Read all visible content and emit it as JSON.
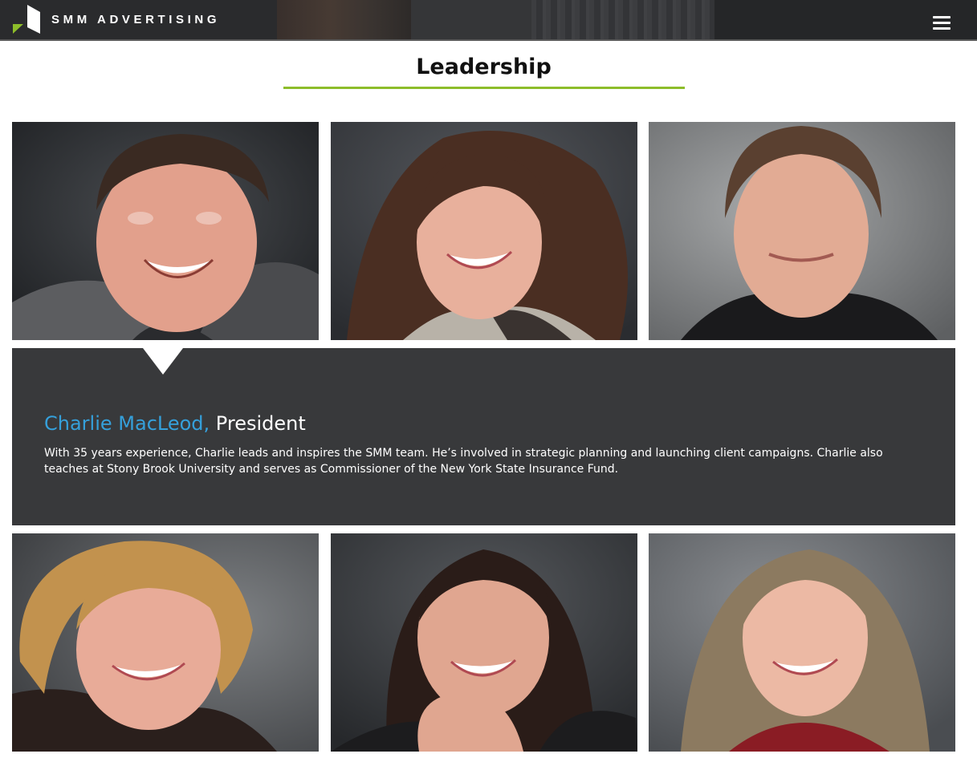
{
  "header": {
    "logo_text": "SMM ADVERTISING",
    "menu_icon": "hamburger-icon",
    "colors": {
      "background": "#2a2b2d",
      "logo_accent": "#8dbd2a",
      "logo_mark": "#ffffff"
    }
  },
  "section": {
    "title": "Leadership",
    "rule_color": "#8dbd2a"
  },
  "team": [
    {
      "photo": "portrait-man-gray-blazer"
    },
    {
      "photo": "portrait-woman-brown-hair"
    },
    {
      "photo": "portrait-man-black-shirt"
    },
    {
      "photo": "portrait-woman-blonde-short-hair"
    },
    {
      "photo": "portrait-woman-dark-hair-hand-on-chin"
    },
    {
      "photo": "portrait-woman-long-hair-red-sweater"
    }
  ],
  "bio": {
    "name": "Charlie MacLeod,",
    "role": "President",
    "description": "With 35 years experience, Charlie leads and inspires the SMM team. He’s involved in strategic planning and launching client campaigns. Charlie also teaches at Stony Brook University and serves as Commissioner of the New York State Insurance Fund.",
    "colors": {
      "panel": "#38393b",
      "name": "#35a0db",
      "text": "#ffffff"
    }
  }
}
